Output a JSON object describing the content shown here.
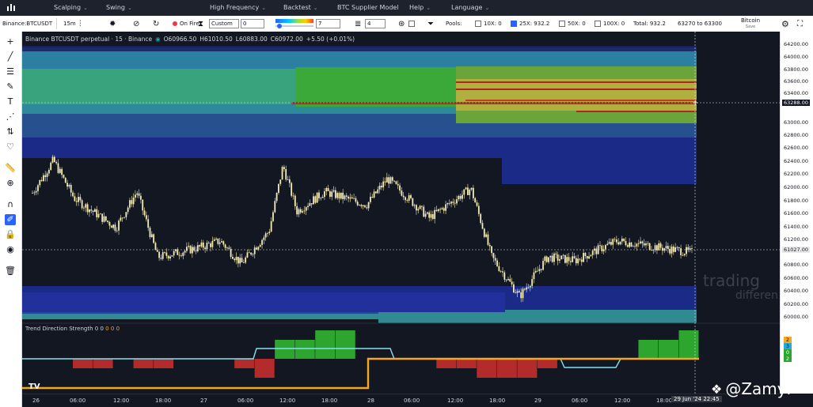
{
  "menubar": {
    "items": [
      {
        "label": "Scalping"
      },
      {
        "label": "Swing"
      },
      {
        "label": "High Frequency"
      },
      {
        "label": "Backtest"
      },
      {
        "label": "BTC Supplier Model"
      },
      {
        "label": "Help"
      },
      {
        "label": "Language"
      }
    ]
  },
  "toolbar": {
    "symbol": "Binance:BTCUSDT",
    "interval": "15m",
    "on_fire": "On Fire",
    "custom_select": "Custom",
    "custom_value": "0",
    "gradient_value": "7",
    "layers_value": "4",
    "pools_label": "Pools:",
    "pool_10x": "10X: 0",
    "pool_25x": "25X: 932.2",
    "pool_50x": "50X: 0",
    "pool_100x": "100X: 0",
    "total": "Total: 932.2",
    "range": "63270 to 63300",
    "coin": "Bitcoin",
    "coin_sub": "Save"
  },
  "legend": {
    "title": "Binance BTCUSDT perpetual · 15 · Binance",
    "open": "O60966.50",
    "high": "H61010.50",
    "low": "L60883.00",
    "close": "C60972.00",
    "change": "+5.50 (+0.01%)"
  },
  "indicator_legend": {
    "label": "Trend Direction Strength",
    "v1": "0",
    "v2": "0",
    "v3": "0",
    "v4": "0",
    "v5": "0"
  },
  "price_axis": {
    "labels": [
      "64200.00",
      "64000.00",
      "63800.00",
      "63600.00",
      "63400.00",
      "63000.00",
      "62800.00",
      "62600.00",
      "62400.00",
      "62200.00",
      "62000.00",
      "61800.00",
      "61600.00",
      "61400.00",
      "61200.00",
      "60800.00",
      "60600.00",
      "60400.00",
      "60200.00",
      "60000.00"
    ],
    "crosshair_price": "63288.00",
    "last_price": "61027.00",
    "ind_labels": [
      "2",
      "3",
      "0",
      "2"
    ]
  },
  "time_axis": {
    "labels": [
      "26",
      "06:00",
      "12:00",
      "18:00",
      "27",
      "06:00",
      "12:00",
      "18:00",
      "28",
      "06:00",
      "12:00",
      "18:00",
      "29",
      "06:00",
      "12:00",
      "18:00"
    ],
    "cursor": "29 Jun '24  22:45"
  },
  "watermark": {
    "trading": "trading",
    "differ": "differen",
    "zamyr": "@Zamyr"
  },
  "colors": {
    "bg": "#131722",
    "candle": "#f4ecb4",
    "heat_green": "#38b000",
    "heat_yellow": "#c8b83a",
    "heat_teal": "#2f9e8f",
    "heat_navy": "#1c2a80",
    "heat_red": "#b3261e",
    "bar_green": "#2ea52e",
    "bar_red": "#b42b2b",
    "line_cyan": "#7fe3ee",
    "line_orange": "#f5a623"
  },
  "chart_data": {
    "type": "candlestick",
    "symbol": "BTCUSDT",
    "interval": "15",
    "close_path": [
      {
        "t": "26 00:00",
        "p": 61880
      },
      {
        "t": "26 03:00",
        "p": 62380
      },
      {
        "t": "26 06:00",
        "p": 61800
      },
      {
        "t": "26 12:00",
        "p": 61350
      },
      {
        "t": "26 15:00",
        "p": 61900
      },
      {
        "t": "26 18:00",
        "p": 60900
      },
      {
        "t": "27 00:00",
        "p": 61050
      },
      {
        "t": "27 03:00",
        "p": 61150
      },
      {
        "t": "27 06:00",
        "p": 60800
      },
      {
        "t": "27 10:00",
        "p": 61300
      },
      {
        "t": "27 12:00",
        "p": 62300
      },
      {
        "t": "27 14:00",
        "p": 61600
      },
      {
        "t": "27 18:00",
        "p": 61900
      },
      {
        "t": "28 00:00",
        "p": 61700
      },
      {
        "t": "28 03:00",
        "p": 62100
      },
      {
        "t": "28 09:00",
        "p": 61500
      },
      {
        "t": "28 15:00",
        "p": 61950
      },
      {
        "t": "28 18:00",
        "p": 60900
      },
      {
        "t": "28 22:00",
        "p": 60300
      },
      {
        "t": "29 02:00",
        "p": 60900
      },
      {
        "t": "29 06:00",
        "p": 60850
      },
      {
        "t": "29 12:00",
        "p": 61150
      },
      {
        "t": "29 22:45",
        "p": 60972
      }
    ],
    "heatmap_levels": [
      {
        "from": 64000,
        "to": 64200,
        "intensity": "navy"
      },
      {
        "from": 63000,
        "to": 64000,
        "intensity": "green-yellow"
      },
      {
        "from": 63270,
        "to": 63300,
        "intensity": "red"
      },
      {
        "from": 62100,
        "to": 62900,
        "intensity": "navy"
      },
      {
        "from": 60300,
        "to": 60500,
        "intensity": "navy"
      },
      {
        "from": 60000,
        "to": 60200,
        "intensity": "teal"
      }
    ],
    "indicator_series": [
      {
        "values": [
          0,
          0,
          -1,
          -1,
          0,
          -1,
          -1,
          0,
          0,
          0,
          -1,
          -2,
          2,
          2,
          3,
          3,
          0,
          0,
          0,
          0,
          -1,
          -1,
          -2,
          -2,
          -2,
          -1,
          0,
          0,
          0,
          0,
          2,
          2,
          3
        ]
      }
    ],
    "ylim": [
      60000,
      64200
    ]
  }
}
